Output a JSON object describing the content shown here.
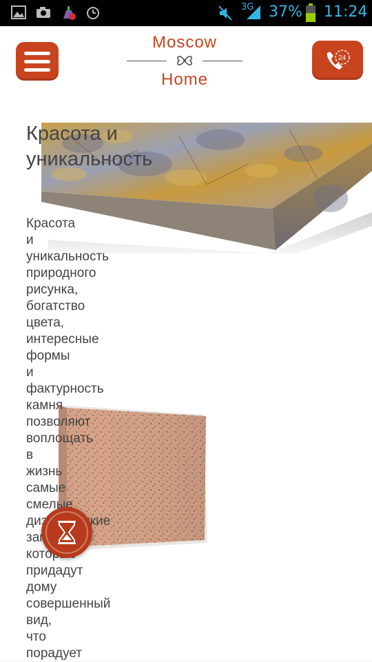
{
  "status_bar": {
    "network": "3G",
    "battery": "37%",
    "time": "11:24",
    "icons": [
      "image-icon",
      "camera-icon",
      "cleaner-icon",
      "alarm-icon",
      "mute-icon",
      "signal-icon",
      "battery-icon"
    ]
  },
  "header": {
    "logo_top": "Moscow",
    "logo_bottom": "Home",
    "menu_icon": "hamburger-icon",
    "phone_icon": "phone-24-icon",
    "phone_badge": "24"
  },
  "content": {
    "heading": "Красота и уникальность",
    "paragraph": "Красота и уникальность природного рисунка, богатство цвета, интересные формы и фактурность камня позволяют воплощать в жизнь самые смелые дизайнерские замыслы, которые придадут дому совершенный вид, что порадует"
  },
  "colors": {
    "accent": "#c8441e",
    "text": "#444444",
    "status_bar": "#000000",
    "status_text": "#33b5e5"
  }
}
